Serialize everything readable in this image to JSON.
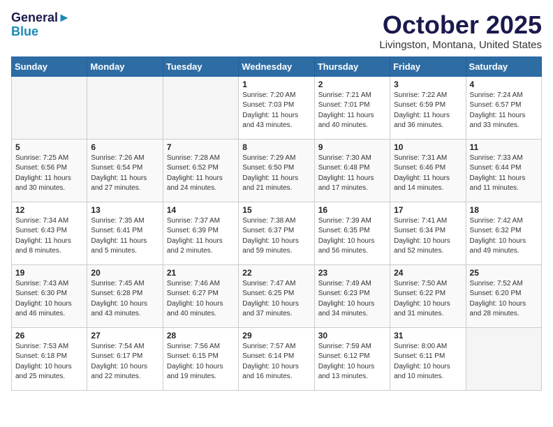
{
  "header": {
    "logo_line1": "General",
    "logo_line2": "Blue",
    "title": "October 2025",
    "subtitle": "Livingston, Montana, United States"
  },
  "days_of_week": [
    "Sunday",
    "Monday",
    "Tuesday",
    "Wednesday",
    "Thursday",
    "Friday",
    "Saturday"
  ],
  "weeks": [
    [
      {
        "day": "",
        "empty": true
      },
      {
        "day": "",
        "empty": true
      },
      {
        "day": "",
        "empty": true
      },
      {
        "day": "1",
        "sunrise": "7:20 AM",
        "sunset": "7:03 PM",
        "daylight": "11 hours and 43 minutes."
      },
      {
        "day": "2",
        "sunrise": "7:21 AM",
        "sunset": "7:01 PM",
        "daylight": "11 hours and 40 minutes."
      },
      {
        "day": "3",
        "sunrise": "7:22 AM",
        "sunset": "6:59 PM",
        "daylight": "11 hours and 36 minutes."
      },
      {
        "day": "4",
        "sunrise": "7:24 AM",
        "sunset": "6:57 PM",
        "daylight": "11 hours and 33 minutes."
      }
    ],
    [
      {
        "day": "5",
        "sunrise": "7:25 AM",
        "sunset": "6:56 PM",
        "daylight": "11 hours and 30 minutes."
      },
      {
        "day": "6",
        "sunrise": "7:26 AM",
        "sunset": "6:54 PM",
        "daylight": "11 hours and 27 minutes."
      },
      {
        "day": "7",
        "sunrise": "7:28 AM",
        "sunset": "6:52 PM",
        "daylight": "11 hours and 24 minutes."
      },
      {
        "day": "8",
        "sunrise": "7:29 AM",
        "sunset": "6:50 PM",
        "daylight": "11 hours and 21 minutes."
      },
      {
        "day": "9",
        "sunrise": "7:30 AM",
        "sunset": "6:48 PM",
        "daylight": "11 hours and 17 minutes."
      },
      {
        "day": "10",
        "sunrise": "7:31 AM",
        "sunset": "6:46 PM",
        "daylight": "11 hours and 14 minutes."
      },
      {
        "day": "11",
        "sunrise": "7:33 AM",
        "sunset": "6:44 PM",
        "daylight": "11 hours and 11 minutes."
      }
    ],
    [
      {
        "day": "12",
        "sunrise": "7:34 AM",
        "sunset": "6:43 PM",
        "daylight": "11 hours and 8 minutes."
      },
      {
        "day": "13",
        "sunrise": "7:35 AM",
        "sunset": "6:41 PM",
        "daylight": "11 hours and 5 minutes."
      },
      {
        "day": "14",
        "sunrise": "7:37 AM",
        "sunset": "6:39 PM",
        "daylight": "11 hours and 2 minutes."
      },
      {
        "day": "15",
        "sunrise": "7:38 AM",
        "sunset": "6:37 PM",
        "daylight": "10 hours and 59 minutes."
      },
      {
        "day": "16",
        "sunrise": "7:39 AM",
        "sunset": "6:35 PM",
        "daylight": "10 hours and 56 minutes."
      },
      {
        "day": "17",
        "sunrise": "7:41 AM",
        "sunset": "6:34 PM",
        "daylight": "10 hours and 52 minutes."
      },
      {
        "day": "18",
        "sunrise": "7:42 AM",
        "sunset": "6:32 PM",
        "daylight": "10 hours and 49 minutes."
      }
    ],
    [
      {
        "day": "19",
        "sunrise": "7:43 AM",
        "sunset": "6:30 PM",
        "daylight": "10 hours and 46 minutes."
      },
      {
        "day": "20",
        "sunrise": "7:45 AM",
        "sunset": "6:28 PM",
        "daylight": "10 hours and 43 minutes."
      },
      {
        "day": "21",
        "sunrise": "7:46 AM",
        "sunset": "6:27 PM",
        "daylight": "10 hours and 40 minutes."
      },
      {
        "day": "22",
        "sunrise": "7:47 AM",
        "sunset": "6:25 PM",
        "daylight": "10 hours and 37 minutes."
      },
      {
        "day": "23",
        "sunrise": "7:49 AM",
        "sunset": "6:23 PM",
        "daylight": "10 hours and 34 minutes."
      },
      {
        "day": "24",
        "sunrise": "7:50 AM",
        "sunset": "6:22 PM",
        "daylight": "10 hours and 31 minutes."
      },
      {
        "day": "25",
        "sunrise": "7:52 AM",
        "sunset": "6:20 PM",
        "daylight": "10 hours and 28 minutes."
      }
    ],
    [
      {
        "day": "26",
        "sunrise": "7:53 AM",
        "sunset": "6:18 PM",
        "daylight": "10 hours and 25 minutes."
      },
      {
        "day": "27",
        "sunrise": "7:54 AM",
        "sunset": "6:17 PM",
        "daylight": "10 hours and 22 minutes."
      },
      {
        "day": "28",
        "sunrise": "7:56 AM",
        "sunset": "6:15 PM",
        "daylight": "10 hours and 19 minutes."
      },
      {
        "day": "29",
        "sunrise": "7:57 AM",
        "sunset": "6:14 PM",
        "daylight": "10 hours and 16 minutes."
      },
      {
        "day": "30",
        "sunrise": "7:59 AM",
        "sunset": "6:12 PM",
        "daylight": "10 hours and 13 minutes."
      },
      {
        "day": "31",
        "sunrise": "8:00 AM",
        "sunset": "6:11 PM",
        "daylight": "10 hours and 10 minutes."
      },
      {
        "day": "",
        "empty": true
      }
    ]
  ]
}
